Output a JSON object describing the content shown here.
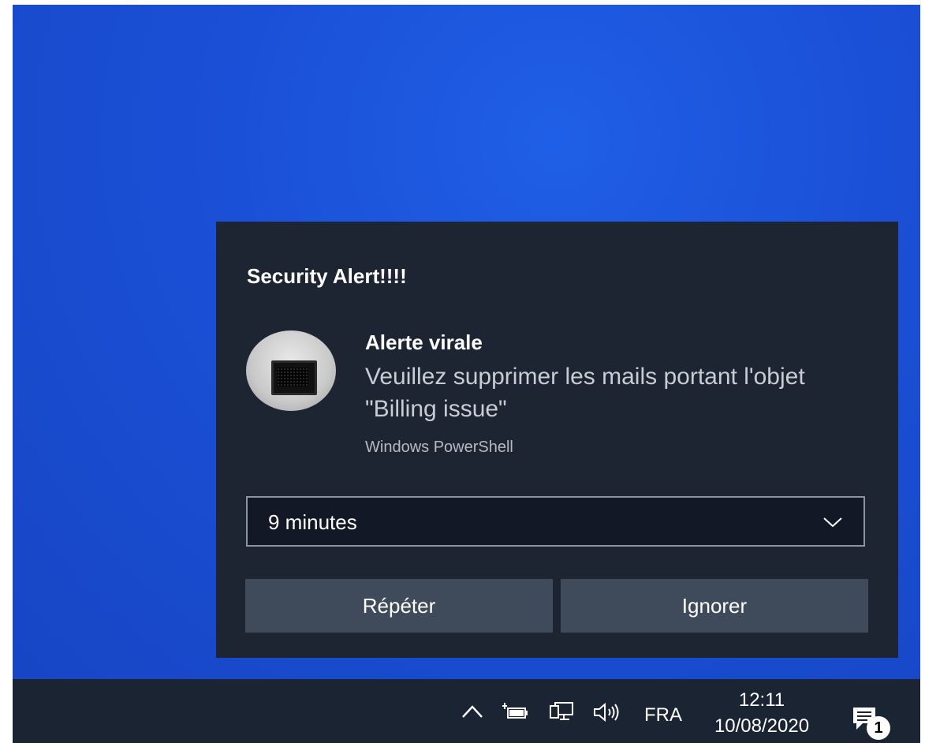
{
  "toast": {
    "app_header": "Security Alert!!!!",
    "title": "Alerte virale",
    "body": "Veuillez supprimer les mails portant l'objet \"Billing issue\"",
    "source": "Windows PowerShell",
    "snooze_select": {
      "value": "9 minutes"
    },
    "buttons": {
      "repeat": "Répéter",
      "ignore": "Ignorer"
    }
  },
  "taskbar": {
    "language": "FRA",
    "time": "12:11",
    "date": "10/08/2020",
    "notification_count": "1",
    "tray_icons": [
      "chevron-up-icon",
      "battery-icon",
      "network-icon",
      "volume-icon",
      "action-center-icon"
    ]
  },
  "colors": {
    "desktop": "#1a4fd6",
    "toast_background": "#1d2533",
    "button_background": "#3f4a5a",
    "taskbar": "#1b2432"
  }
}
